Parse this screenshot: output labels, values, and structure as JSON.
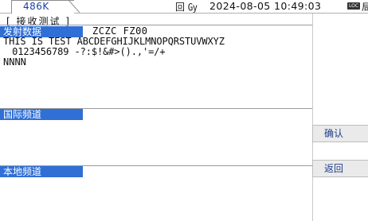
{
  "status": {
    "frequency": "486K",
    "icons": "回 ㏉",
    "datetime": "2024-08-05 10:49:03",
    "loc_badge": "LOC",
    "tail": "局"
  },
  "page": {
    "title": "[ 接收测试 ]"
  },
  "sections": {
    "send_data": {
      "label": "发射数据",
      "header": "ZCZC FZ00",
      "lines": [
        "THIS IS TEST ABCDEFGHIJKLMNOPQRSTUVWXYZ",
        " 0123456789 -?:$!&#>().,'=/+",
        "NNNN"
      ]
    },
    "intl_channel": {
      "label": "国际频道"
    },
    "local_channel": {
      "label": "本地频道"
    }
  },
  "side_buttons": {
    "confirm": "确认",
    "back": "返回"
  }
}
